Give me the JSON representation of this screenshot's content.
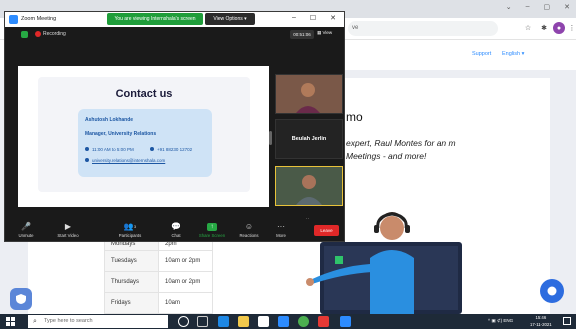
{
  "browser": {
    "url_fragment": "ve",
    "window_controls": [
      "⌄",
      "–",
      "▢",
      "✕"
    ]
  },
  "site": {
    "nav": {
      "support": "Support",
      "language": "English ▾"
    },
    "demo_heading": "mo",
    "demo_text": "expert, Raul Montes for an m Meetings - and more!",
    "schedule": [
      {
        "day": "Mondays",
        "time": "2pm"
      },
      {
        "day": "Tuesdays",
        "time": "10am or 2pm"
      },
      {
        "day": "Thursdays",
        "time": "10am or 2pm"
      },
      {
        "day": "Fridays",
        "time": "10am"
      }
    ]
  },
  "zoom": {
    "title": "Zoom Meeting",
    "share_banner": "You are viewing Internshala's screen",
    "view_options": "View Options ▾",
    "window_controls": [
      "–",
      "☐",
      "✕"
    ],
    "recording": "Recording",
    "timer": "00:51:06",
    "view_btn": "▦ View",
    "slide": {
      "title": "Contact us",
      "name": "Ashutosh Lokhande",
      "role": "Manager, University Relations",
      "hours": "11:00 AM to 5:00 PM",
      "phone": "+91 88230 12702",
      "email": "university.relations@internshala.com"
    },
    "participant_name": "Beulah Jerlin",
    "controls": [
      {
        "icon": "🎤",
        "label": "Unmute"
      },
      {
        "icon": "▶",
        "label": "Start Video"
      },
      {
        "icon": "👥",
        "label": "Participants",
        "count": "3"
      },
      {
        "icon": "💬",
        "label": "Chat"
      },
      {
        "icon": "↑",
        "label": "Share Screen"
      },
      {
        "icon": "☺",
        "label": "Reactions"
      },
      {
        "icon": "···",
        "label": "More"
      }
    ],
    "leave": "Leave"
  },
  "taskbar": {
    "search_placeholder": "Type here to search",
    "tray": "^ ▣ ⊄) ENG",
    "time": "15:46",
    "date": "17-11-2021"
  },
  "colors": {
    "zoom_blue": "#2d8cff",
    "share_green": "#1f9d3a",
    "leave_red": "#e02828",
    "slide_card": "#cfe3f6",
    "taskbar": "#1e2a38"
  }
}
